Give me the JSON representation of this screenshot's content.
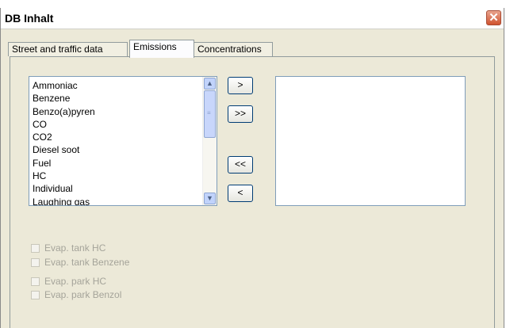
{
  "window": {
    "title": "DB Inhalt",
    "close_glyph": "✕"
  },
  "tabs": [
    {
      "label": "Street and traffic data",
      "selected": false
    },
    {
      "label": "Emissions",
      "selected": true
    },
    {
      "label": "Concentrations",
      "selected": false
    }
  ],
  "source_list": {
    "items": [
      "Ammoniac",
      "Benzene",
      "Benzo(a)pyren",
      "CO",
      "CO2",
      "Diesel soot",
      "Fuel",
      "HC",
      "Individual",
      "Laughing gas"
    ],
    "scroll_up_glyph": "▲",
    "scroll_down_glyph": "▼",
    "scroll_grip_glyph": "≡"
  },
  "transfer_buttons": {
    "add_one": ">",
    "add_all": ">>",
    "remove_all": "<<",
    "remove_one": "<"
  },
  "target_list": {
    "items": []
  },
  "checkboxes": [
    {
      "label": "Evap. tank HC",
      "checked": false,
      "enabled": false
    },
    {
      "label": "Evap. tank Benzene",
      "checked": false,
      "enabled": false
    },
    {
      "label": "Evap. park HC",
      "checked": false,
      "enabled": false
    },
    {
      "label": "Evap. park Benzol",
      "checked": false,
      "enabled": false
    }
  ],
  "colors": {
    "dialog_bg": "#ece9d8",
    "close_button": "#d0532f",
    "list_border": "#7f9db9",
    "disabled_text": "#a5a49a"
  }
}
